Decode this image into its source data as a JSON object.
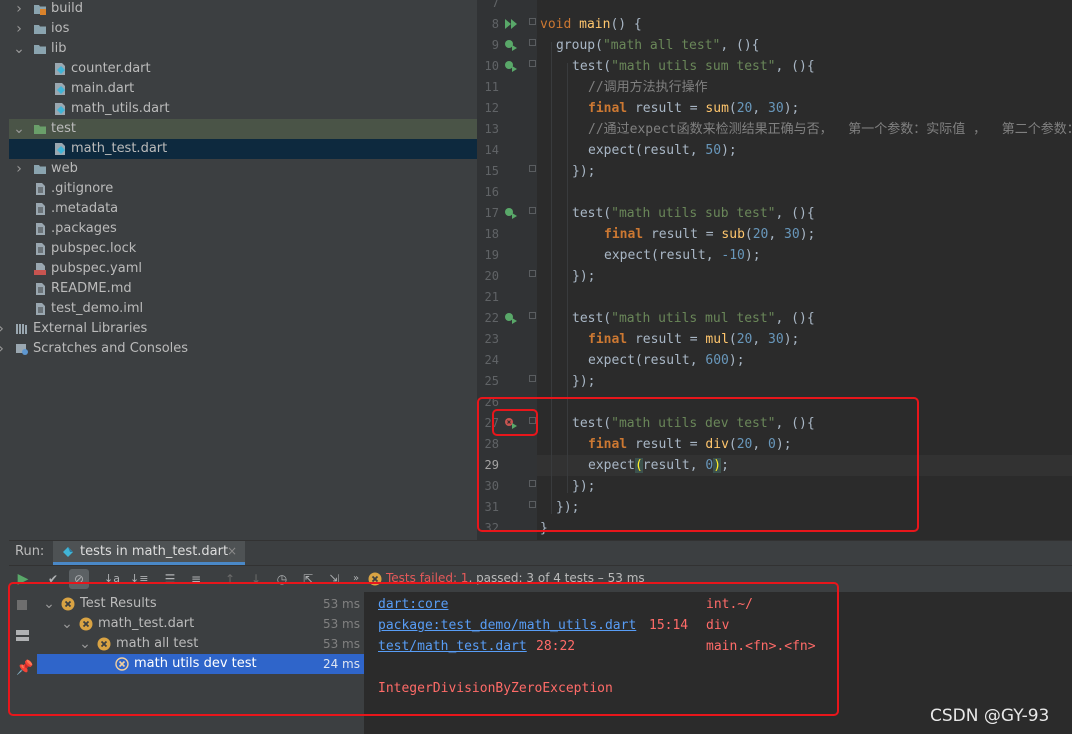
{
  "project_tree": [
    {
      "label": "build",
      "icon": "folder-orange-icon",
      "chev": "right"
    },
    {
      "label": "ios",
      "icon": "folder-icon",
      "chev": "right"
    },
    {
      "label": "lib",
      "icon": "folder-icon",
      "chev": "down"
    },
    {
      "label": "counter.dart",
      "icon": "dart-file-icon",
      "chev": ""
    },
    {
      "label": "main.dart",
      "icon": "dart-file-icon",
      "chev": ""
    },
    {
      "label": "math_utils.dart",
      "icon": "dart-file-icon",
      "chev": ""
    },
    {
      "label": "test",
      "icon": "folder-green-icon",
      "chev": "down"
    },
    {
      "label": "math_test.dart",
      "icon": "dart-file-icon",
      "chev": ""
    },
    {
      "label": "web",
      "icon": "folder-icon",
      "chev": "right"
    },
    {
      "label": ".gitignore",
      "icon": "text-file-icon",
      "chev": ""
    },
    {
      "label": ".metadata",
      "icon": "text-file-icon",
      "chev": ""
    },
    {
      "label": ".packages",
      "icon": "text-file-icon",
      "chev": ""
    },
    {
      "label": "pubspec.lock",
      "icon": "text-file-icon",
      "chev": ""
    },
    {
      "label": "pubspec.yaml",
      "icon": "yaml-file-icon",
      "chev": ""
    },
    {
      "label": "README.md",
      "icon": "text-file-icon",
      "chev": ""
    },
    {
      "label": "test_demo.iml",
      "icon": "text-file-icon",
      "chev": ""
    },
    {
      "label": "External Libraries",
      "icon": "libraries-icon",
      "chev": "right"
    },
    {
      "label": "Scratches and Consoles",
      "icon": "scratches-icon",
      "chev": "right"
    }
  ],
  "editor": {
    "line_numbers": [
      "7",
      "8",
      "9",
      "10",
      "11",
      "12",
      "13",
      "14",
      "15",
      "16",
      "17",
      "18",
      "19",
      "20",
      "21",
      "22",
      "23",
      "24",
      "25",
      "26",
      "27",
      "28",
      "29",
      "30",
      "31",
      "32"
    ],
    "current_line": "29"
  },
  "code": {
    "l8": [
      "void ",
      "main",
      "() {"
    ],
    "l9": [
      "group(",
      "\"math all test\"",
      ", (){"
    ],
    "l10": [
      "test(",
      "\"math utils sum test\"",
      ", (){"
    ],
    "l11": "//调用方法执行操作",
    "l12": [
      "final ",
      "result = ",
      "sum",
      "(",
      "20",
      ", ",
      "30",
      ");"
    ],
    "l13": "//通过expect函数来检测结果正确与否，  第一个参数：实际值 ，  第二个参数：预",
    "l14": [
      "expect(result, ",
      "50",
      ");"
    ],
    "l15": "});",
    "l17": [
      "test(",
      "\"math utils sub test\"",
      ", (){"
    ],
    "l18": [
      "final ",
      "result = ",
      "sub",
      "(",
      "20",
      ", ",
      "30",
      ");"
    ],
    "l19": [
      "expect(result, ",
      "-10",
      ");"
    ],
    "l20": "});",
    "l22": [
      "test(",
      "\"math utils mul test\"",
      ", (){"
    ],
    "l23": [
      "final ",
      "result = ",
      "mul",
      "(",
      "20",
      ", ",
      "30",
      ");"
    ],
    "l24": [
      "expect(result, ",
      "600",
      ");"
    ],
    "l25": "});",
    "l27": [
      "test(",
      "\"math utils dev test\"",
      ", (){"
    ],
    "l28": [
      "final ",
      "result = ",
      "div",
      "(",
      "20",
      ", ",
      "0",
      ");"
    ],
    "l29": [
      "expect",
      "(",
      "result, ",
      "0",
      ")",
      ";"
    ],
    "l30": "});",
    "l31": "});",
    "l32": "}"
  },
  "run": {
    "label": "Run:",
    "tab": "tests in math_test.dart",
    "status_failed": "Tests failed: 1",
    "status_rest": ", passed: 3 of 4 tests – 53 ms"
  },
  "test_results": [
    {
      "label": "Test Results",
      "time": "53 ms"
    },
    {
      "label": "math_test.dart",
      "time": "53 ms"
    },
    {
      "label": "math all test",
      "time": "53 ms"
    },
    {
      "label": "math utils dev test",
      "time": "24 ms"
    }
  ],
  "console": {
    "links": [
      "dart:core",
      "package:test_demo/math_utils.dart",
      "test/math_test.dart"
    ],
    "locations": [
      "",
      "15:14",
      "28:22"
    ],
    "members": [
      "int.~/",
      "div",
      "main.<fn>.<fn>"
    ],
    "exception": "IntegerDivisionByZeroException"
  },
  "watermark": "CSDN @GY-93"
}
